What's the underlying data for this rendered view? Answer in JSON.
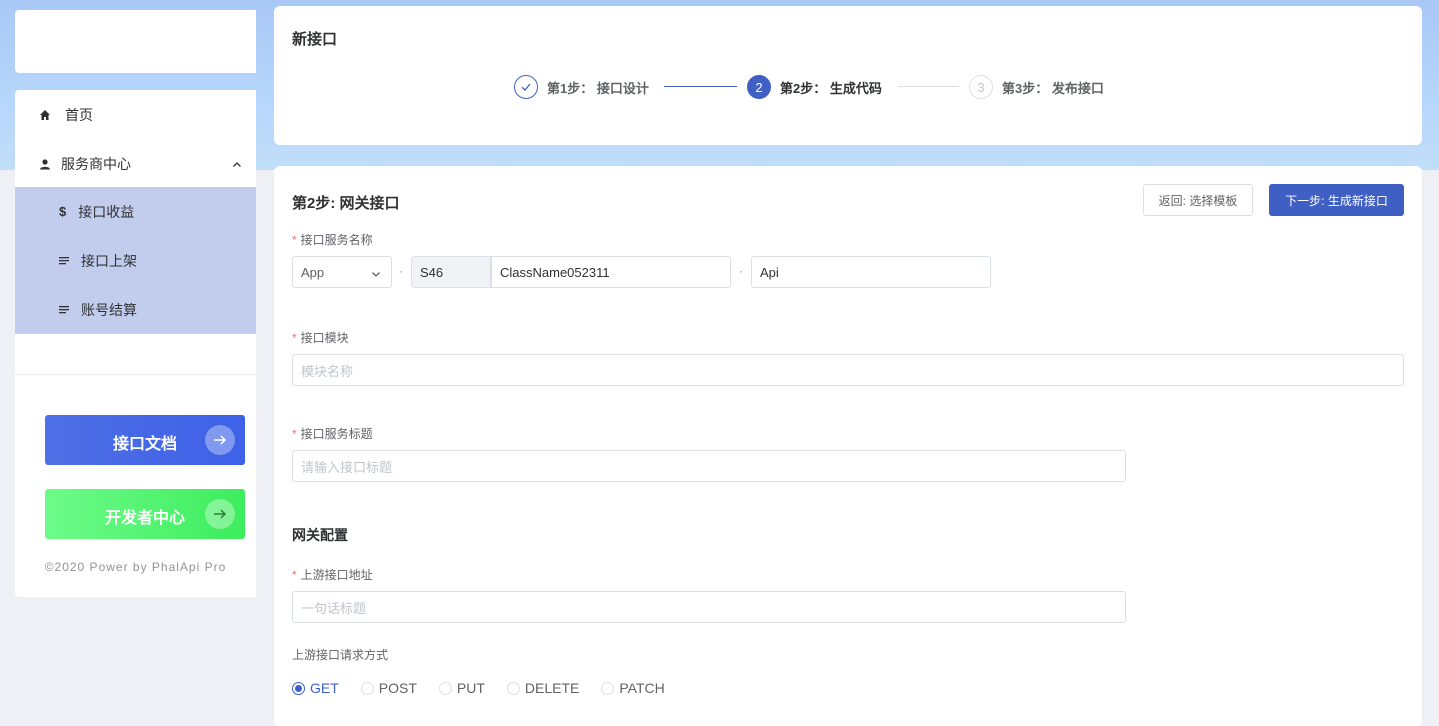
{
  "sidebar": {
    "items": [
      {
        "label": "首页",
        "icon": "home-icon"
      },
      {
        "label": "服务商中心",
        "icon": "user-icon",
        "expanded": true
      }
    ],
    "sub_items": [
      {
        "label": "接口收益",
        "icon": "dollar-icon"
      },
      {
        "label": "接口上架",
        "icon": "list-icon"
      },
      {
        "label": "账号结算",
        "icon": "list-icon"
      }
    ],
    "doc_button": "接口文档",
    "dev_button": "开发者中心",
    "copyright": "©2020 Power by PhalApi Pro"
  },
  "header": {
    "title": "新接口",
    "steps": [
      {
        "label": "第1步： 接口设计",
        "status": "done"
      },
      {
        "label": "第2步： 生成代码",
        "status": "active",
        "number": "2"
      },
      {
        "label": "第3步： 发布接口",
        "status": "pending",
        "number": "3"
      }
    ]
  },
  "form": {
    "section_title": "第2步: 网关接口",
    "back_button": "返回: 选择模板",
    "next_button": "下一步: 生成新接口",
    "service_name_label": "接口服务名称",
    "app_select": "App",
    "separator": "·",
    "prefix": "S46",
    "class_name": "ClassName052311",
    "api_suffix": "Api",
    "module_label": "接口模块",
    "module_placeholder": "模块名称",
    "title_label": "接口服务标题",
    "title_placeholder": "请输入接口标题",
    "gateway_title": "网关配置",
    "upstream_label": "上游接口地址",
    "upstream_placeholder": "一句话标题",
    "method_label": "上游接口请求方式",
    "methods": [
      "GET",
      "POST",
      "PUT",
      "DELETE",
      "PATCH"
    ],
    "selected_method": "GET"
  },
  "colors": {
    "primary": "#3f5fc4",
    "submenu_bg": "#c2cdee",
    "doc_button": "#4a6ae6",
    "dev_button": "#4ef26c",
    "required": "#f56c6c"
  }
}
